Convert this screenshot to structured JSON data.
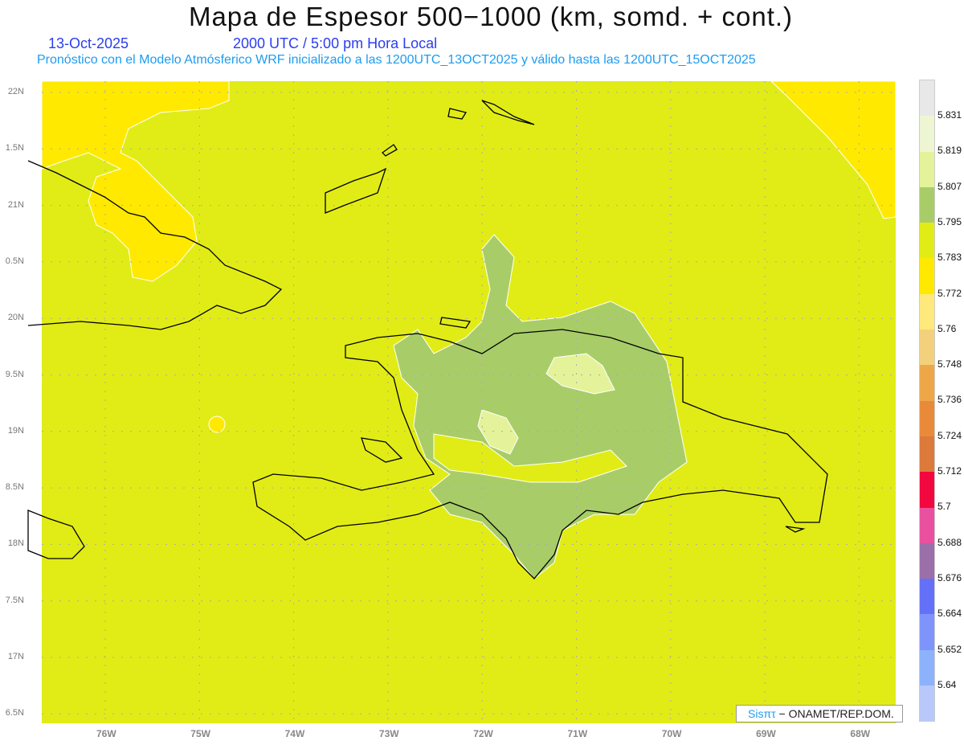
{
  "header": {
    "title": "Mapa de Espesor 500−1000 (km, somd. + cont.)",
    "date": "13-Oct-2025",
    "time": "2000 UTC / 5:00 pm Hora Local",
    "subtitle": "Pronóstico con el Modelo Atmósferico WRF inicializado a las 1200UTC_13OCT2025 y válido hasta las  1200UTC_15OCT2025"
  },
  "map": {
    "lat_labels": [
      "22N",
      "1.5N",
      "21N",
      "0.5N",
      "20N",
      "9.5N",
      "19N",
      "8.5N",
      "18N",
      "7.5N",
      "17N",
      "6.5N"
    ],
    "lon_labels": [
      "76W",
      "75W",
      "74W",
      "73W",
      "72W",
      "71W",
      "70W",
      "69W",
      "68W"
    ],
    "background_color": "#e1ec16"
  },
  "colorbar": {
    "colors": [
      "#e8e8e8",
      "#eef5d3",
      "#e4f29a",
      "#a8cd68",
      "#e1ec16",
      "#ffe900",
      "#ffe97d",
      "#f3d07c",
      "#eda747",
      "#e88a3a",
      "#db7a3a",
      "#f2083e",
      "#ea50a0",
      "#9b6fa8",
      "#6470f8",
      "#7f94fb",
      "#8cb2fb",
      "#b8c8fb"
    ],
    "labels": [
      "5.831",
      "5.819",
      "5.807",
      "5.795",
      "5.783",
      "5.772",
      "5.76",
      "5.748",
      "5.736",
      "5.724",
      "5.712",
      "5.7",
      "5.688",
      "5.676",
      "5.664",
      "5.652",
      "5.64"
    ]
  },
  "credit": {
    "brand": "Sisπτ",
    "text": "− ONAMET/REP.DOM."
  }
}
